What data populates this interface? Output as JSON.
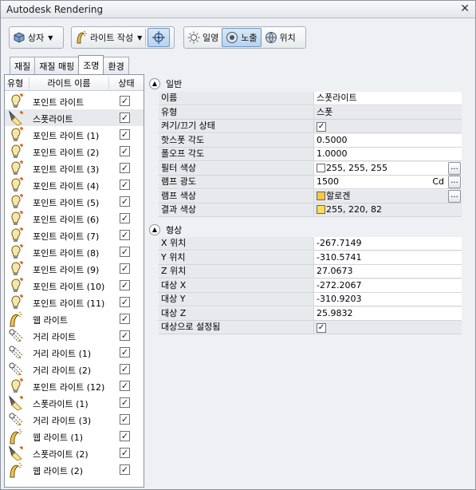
{
  "window": {
    "title": "Autodesk Rendering",
    "close": "✕"
  },
  "toolbar": {
    "box_label": "상자",
    "light_create_label": "라이트 작성",
    "sun_label": "일영",
    "exposure_label": "노출",
    "location_label": "위치"
  },
  "tabs": [
    "재질",
    "재질 매핑",
    "조명",
    "환경"
  ],
  "lights_header": {
    "type": "유형",
    "name": "라이트 이름",
    "state": "상태"
  },
  "lights": [
    {
      "icon": "point-light-icon",
      "name": "포인트 라이트",
      "on": true
    },
    {
      "icon": "spot-light-icon",
      "name": "스폿라이트",
      "on": true,
      "selected": true
    },
    {
      "icon": "point-light-icon",
      "name": "포인트 라이트 (1)",
      "on": true
    },
    {
      "icon": "point-light-icon",
      "name": "포인트 라이트 (2)",
      "on": true
    },
    {
      "icon": "point-light-icon",
      "name": "포인트 라이트 (3)",
      "on": true
    },
    {
      "icon": "point-light-icon",
      "name": "포인트 라이트 (4)",
      "on": true
    },
    {
      "icon": "point-light-icon",
      "name": "포인트 라이트 (5)",
      "on": true
    },
    {
      "icon": "point-light-icon",
      "name": "포인트 라이트 (6)",
      "on": true
    },
    {
      "icon": "point-light-icon",
      "name": "포인트 라이트 (7)",
      "on": true
    },
    {
      "icon": "point-light-icon",
      "name": "포인트 라이트 (8)",
      "on": true
    },
    {
      "icon": "point-light-icon",
      "name": "포인트 라이트 (9)",
      "on": true
    },
    {
      "icon": "point-light-icon",
      "name": "포인트 라이트 (10)",
      "on": true
    },
    {
      "icon": "point-light-icon",
      "name": "포인트 라이트 (11)",
      "on": true
    },
    {
      "icon": "web-light-icon",
      "name": "웹 라이트",
      "on": true
    },
    {
      "icon": "distant-light-icon",
      "name": "거리 라이트",
      "on": true
    },
    {
      "icon": "distant-light-icon",
      "name": "거리 라이트 (1)",
      "on": true
    },
    {
      "icon": "distant-light-icon",
      "name": "거리 라이트 (2)",
      "on": true
    },
    {
      "icon": "point-light-icon",
      "name": "포인트 라이트 (12)",
      "on": true
    },
    {
      "icon": "spot-light-icon",
      "name": "스폿라이트 (1)",
      "on": true
    },
    {
      "icon": "distant-light-icon",
      "name": "거리 라이트 (3)",
      "on": true
    },
    {
      "icon": "web-light-icon",
      "name": "웹 라이트 (1)",
      "on": true
    },
    {
      "icon": "spot-light-icon",
      "name": "스폿라이트 (2)",
      "on": true
    },
    {
      "icon": "web-light-icon",
      "name": "웹 라이트 (2)",
      "on": true
    }
  ],
  "general": {
    "title": "일반",
    "rows": [
      {
        "label": "이름",
        "value": "스폿라이트",
        "kind": "text"
      },
      {
        "label": "유형",
        "value": "스폿",
        "kind": "gray"
      },
      {
        "label": "켜기/끄기 상태",
        "value": "",
        "kind": "check"
      },
      {
        "label": "핫스폿 각도",
        "value": "0.5000",
        "kind": "text"
      },
      {
        "label": "폴오프 각도",
        "value": "1.0000",
        "kind": "text"
      },
      {
        "label": "필터 색상",
        "value": "255, 255, 255",
        "kind": "color",
        "color": "#ffffff",
        "ellipsis": "..."
      },
      {
        "label": "램프 광도",
        "value": "1500",
        "kind": "unit",
        "unit": "Cd",
        "ellipsis": "..."
      },
      {
        "label": "램프 색상",
        "value": "할로겐",
        "kind": "color-gray",
        "color": "#f7c842",
        "ellipsis": "..."
      },
      {
        "label": "결과 색상",
        "value": "255, 220, 82",
        "kind": "color-gray",
        "color": "#ffdc52"
      }
    ]
  },
  "shape": {
    "title": "형상",
    "rows": [
      {
        "label": "X 위치",
        "value": "-267.7149",
        "kind": "text"
      },
      {
        "label": "Y 위치",
        "value": "-310.5741",
        "kind": "text"
      },
      {
        "label": "Z 위치",
        "value": "27.0673",
        "kind": "text"
      },
      {
        "label": "대상 X",
        "value": "-272.2067",
        "kind": "text"
      },
      {
        "label": "대상 Y",
        "value": "-310.9203",
        "kind": "text"
      },
      {
        "label": "대상 Z",
        "value": "25.9832",
        "kind": "text"
      },
      {
        "label": "대상으로 설정됨",
        "value": "",
        "kind": "check-gray"
      }
    ]
  }
}
